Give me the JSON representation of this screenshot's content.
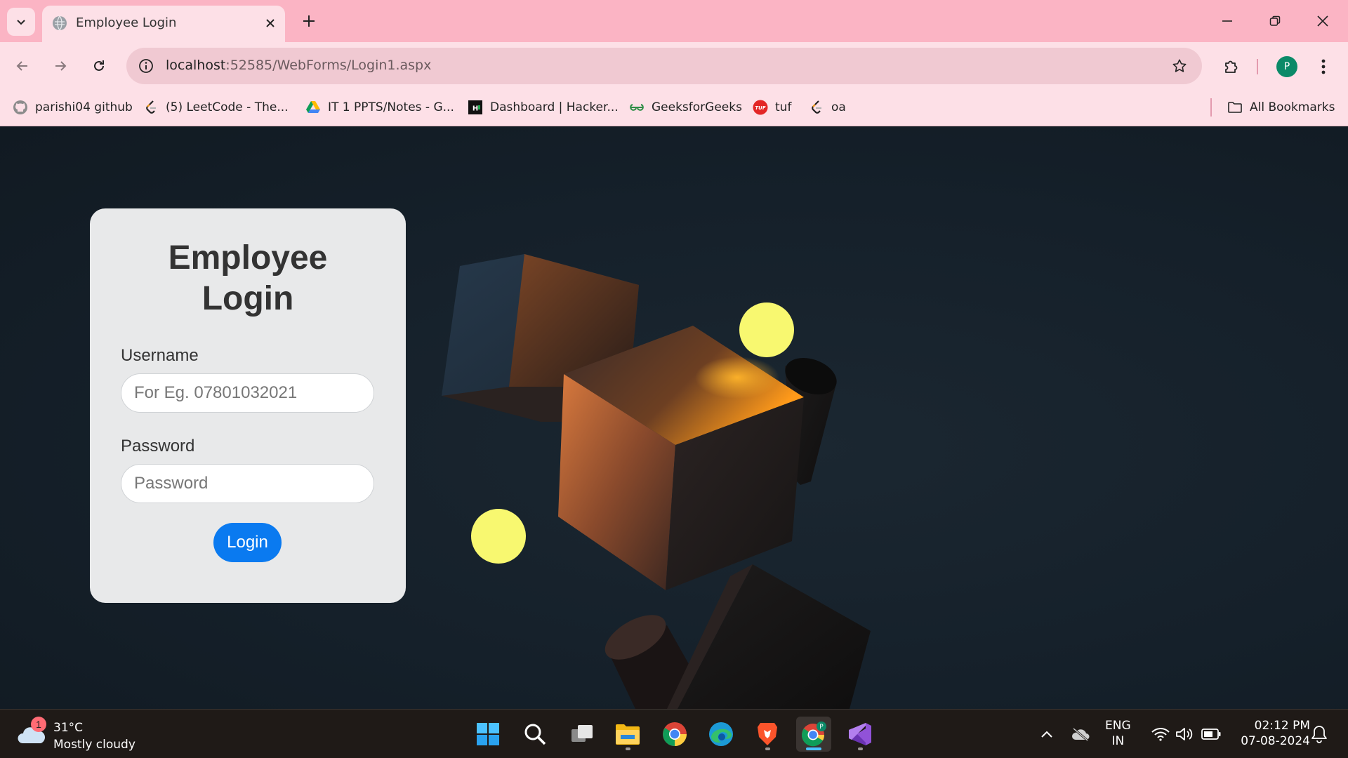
{
  "tab": {
    "title": "Employee Login"
  },
  "address_bar": {
    "host": "localhost",
    "path": ":52585/WebForms/Login1.aspx"
  },
  "profile_initial": "P",
  "bookmarks": {
    "items": [
      {
        "label": "parishi04 github",
        "icon": "github-icon"
      },
      {
        "label": "(5) LeetCode - The...",
        "icon": "leetcode-icon"
      },
      {
        "label": "IT 1 PPTS/Notes - G...",
        "icon": "google-drive-icon"
      },
      {
        "label": "Dashboard | Hacker...",
        "icon": "hackerrank-icon"
      },
      {
        "label": "GeeksforGeeks",
        "icon": "geeksforgeeks-icon"
      },
      {
        "label": "tuf",
        "icon": "tuf-icon"
      },
      {
        "label": "oa",
        "icon": "leetcode-icon"
      }
    ],
    "all_label": "All Bookmarks"
  },
  "login": {
    "title_line1": "Employee",
    "title_line2": "Login",
    "username_label": "Username",
    "username_placeholder": "For Eg. 07801032021",
    "password_label": "Password",
    "password_placeholder": "Password",
    "button_label": "Login"
  },
  "taskbar": {
    "weather": {
      "badge": "1",
      "temp": "31°C",
      "condition": "Mostly cloudy"
    },
    "apps": [
      "windows-start-icon",
      "search-icon",
      "task-view-icon",
      "file-explorer-icon",
      "chrome-icon",
      "edge-icon",
      "brave-icon",
      "chrome-profile-icon",
      "visual-studio-icon"
    ],
    "language": {
      "line1": "ENG",
      "line2": "IN"
    },
    "clock": {
      "time": "02:12 PM",
      "date": "07-08-2024"
    }
  },
  "colors": {
    "tab_bar": "#fbb4c4",
    "toolbar": "#fde0e7",
    "page_background": "#15202a",
    "card": "#e8e9ea",
    "login_button": "#0a7af0",
    "sphere": "#f8f870"
  }
}
